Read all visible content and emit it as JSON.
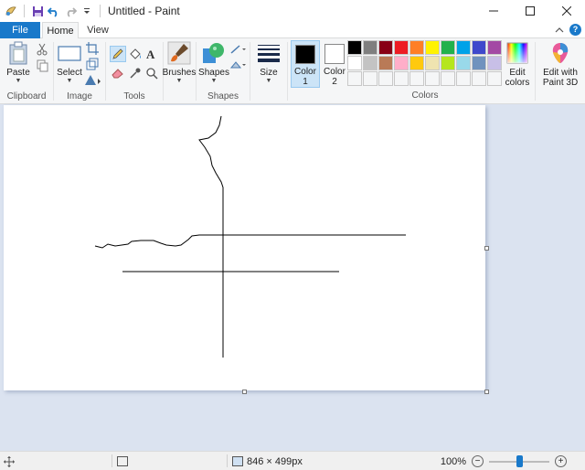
{
  "window": {
    "title": "Untitled - Paint"
  },
  "tabs": [
    {
      "label": "File"
    },
    {
      "label": "Home"
    },
    {
      "label": "View"
    }
  ],
  "ribbon": {
    "clipboard": {
      "paste_label": "Paste",
      "group_label": "Clipboard"
    },
    "image": {
      "select_label": "Select",
      "group_label": "Image"
    },
    "tools": {
      "group_label": "Tools"
    },
    "brushes": {
      "label": "Brushes"
    },
    "shapes": {
      "label": "Shapes",
      "group_label": "Shapes"
    },
    "size": {
      "label": "Size"
    },
    "colors": {
      "color1_label": "Color",
      "color1_num": "1",
      "color2_label": "Color",
      "color2_num": "2",
      "color1_value": "#000000",
      "color2_value": "#ffffff",
      "edit_colors_line1": "Edit",
      "edit_colors_line2": "colors",
      "group_label": "Colors",
      "palette_row1": [
        "#000000",
        "#7f7f7f",
        "#880015",
        "#ed1c24",
        "#ff7f27",
        "#fff200",
        "#22b14c",
        "#00a2e8",
        "#3f48cc",
        "#a349a4"
      ],
      "palette_row2": [
        "#ffffff",
        "#c3c3c3",
        "#b97a57",
        "#ffaec9",
        "#ffc90e",
        "#efe4b0",
        "#b5e61d",
        "#99d9ea",
        "#7092be",
        "#c8bfe7"
      ]
    },
    "paint3d": {
      "line1": "Edit with",
      "line2": "Paint 3D"
    }
  },
  "status": {
    "canvas_size": "846 × 499px",
    "zoom": "100%",
    "zoom_slider_value": 0.5
  }
}
